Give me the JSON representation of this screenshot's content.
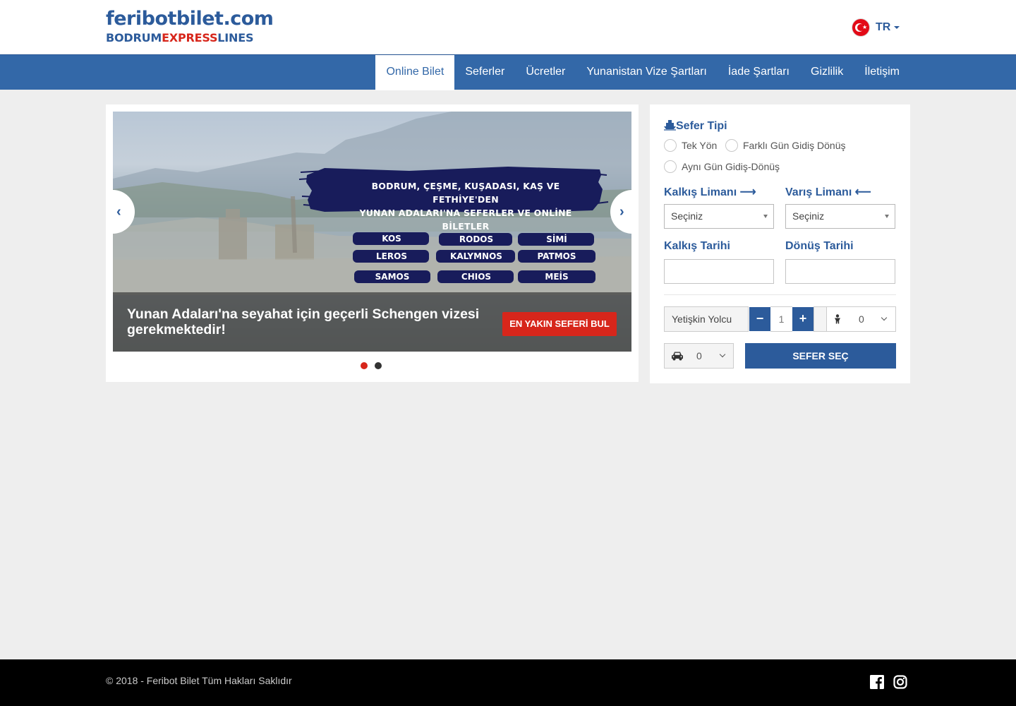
{
  "header": {
    "logo_main": "feribotbilet.com",
    "logo_sub_part1": "BODRUM",
    "logo_sub_part2": "EXPRESS",
    "logo_sub_part3": "LINES",
    "language": "TR",
    "flag_icon": "turkey-flag-icon"
  },
  "nav": {
    "items": [
      {
        "label": "Online Bilet",
        "active": true
      },
      {
        "label": "Seferler"
      },
      {
        "label": "Ücretler"
      },
      {
        "label": "Yunanistan Vize Şartları"
      },
      {
        "label": "İade Şartları"
      },
      {
        "label": "Gizlilik"
      },
      {
        "label": "İletişim"
      }
    ]
  },
  "slider": {
    "banner_line1": "BODRUM, ÇEŞME, KUŞADASI, KAŞ VE FETHİYE'DEN",
    "banner_line2": "YUNAN ADALARI'NA SEFERLER VE ONLİNE BİLETLER",
    "islands": [
      "KOS",
      "RODOS",
      "SİMİ",
      "LEROS",
      "KALYMNOS",
      "PATMOS",
      "SAMOS",
      "CHIOS",
      "MEİS"
    ],
    "caption": "Yunan Adaları'na seyahat için geçerli Schengen vizesi gerekmektedir!",
    "cta_label": "EN YAKIN SEFERİ BUL",
    "slide_count": 2,
    "active_slide": 1,
    "prev_icon": "chevron-left-icon",
    "next_icon": "chevron-right-icon"
  },
  "booking": {
    "trip_type_label": "Sefer Tipi",
    "trip_type_icon": "ship-icon",
    "options": {
      "one_way": "Tek Yön",
      "diff_day": "Farklı Gün Gidiş Dönüş",
      "same_day": "Aynı Gün Gidiş-Dönüş"
    },
    "departure_port_label": "Kalkış Limanı",
    "arrival_port_label": "Varış Limanı",
    "departure_port_value": "Seçiniz",
    "arrival_port_value": "Seçiniz",
    "departure_date_label": "Kalkış Tarihi",
    "return_date_label": "Dönüş Tarihi",
    "departure_date_value": "",
    "return_date_value": "",
    "adult_label": "Yetişkin Yolcu",
    "adult_count": "1",
    "child_count": "0",
    "vehicle_count": "0",
    "submit_label": "SEFER SEÇ"
  },
  "footer": {
    "copyright": "© 2018 - Feribot Bilet Tüm Hakları Saklıdır",
    "social": [
      "facebook-icon",
      "instagram-icon"
    ]
  },
  "colors": {
    "brand_blue": "#2c5b9b",
    "nav_blue": "#3368a8",
    "accent_red": "#d7261b",
    "page_bg": "#eeeeee",
    "footer_bg": "#000000"
  }
}
